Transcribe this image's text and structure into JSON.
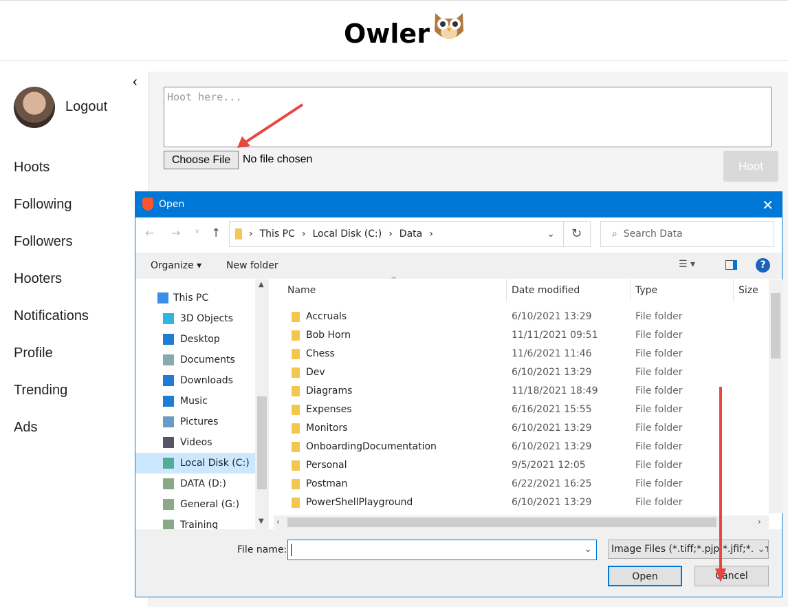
{
  "app": {
    "title": "Owler",
    "logo_icon": "owl-icon"
  },
  "sidebar": {
    "logout": "Logout",
    "items": [
      "Hoots",
      "Following",
      "Followers",
      "Hooters",
      "Notifications",
      "Profile",
      "Trending",
      "Ads"
    ]
  },
  "composer": {
    "placeholder": "Hoot here...",
    "choose_file": "Choose File",
    "no_file": "No file chosen",
    "hoot": "Hoot"
  },
  "dialog": {
    "title": "Open",
    "breadcrumb": [
      "This PC",
      "Local Disk (C:)",
      "Data"
    ],
    "search_placeholder": "Search Data",
    "organize": "Organize ▾",
    "new_folder": "New folder",
    "nav": [
      "This PC",
      "3D Objects",
      "Desktop",
      "Documents",
      "Downloads",
      "Music",
      "Pictures",
      "Videos",
      "Local Disk (C:)",
      "DATA (D:)",
      "General (G:)",
      "Training (\\\\atlsnf"
    ],
    "selected_nav": "Local Disk (C:)",
    "columns": [
      "Name",
      "Date modified",
      "Type",
      "Size"
    ],
    "files": [
      {
        "name": "Accruals",
        "date": "6/10/2021 13:29",
        "type": "File folder"
      },
      {
        "name": "Bob Horn",
        "date": "11/11/2021 09:51",
        "type": "File folder"
      },
      {
        "name": "Chess",
        "date": "11/6/2021 11:46",
        "type": "File folder"
      },
      {
        "name": "Dev",
        "date": "6/10/2021 13:29",
        "type": "File folder"
      },
      {
        "name": "Diagrams",
        "date": "11/18/2021 18:49",
        "type": "File folder"
      },
      {
        "name": "Expenses",
        "date": "6/16/2021 15:55",
        "type": "File folder"
      },
      {
        "name": "Monitors",
        "date": "6/10/2021 13:29",
        "type": "File folder"
      },
      {
        "name": "OnboardingDocumentation",
        "date": "6/10/2021 13:29",
        "type": "File folder"
      },
      {
        "name": "Personal",
        "date": "9/5/2021 12:05",
        "type": "File folder"
      },
      {
        "name": "Postman",
        "date": "6/22/2021 16:25",
        "type": "File folder"
      },
      {
        "name": "PowerShellPlayground",
        "date": "6/10/2021 13:29",
        "type": "File folder"
      }
    ],
    "file_name_label": "File name:",
    "file_name_value": "",
    "filter": "Image Files (*.tiff;*.pjp;*.jfif;*.bm",
    "open": "Open",
    "cancel": "Cancel"
  },
  "colors": {
    "titlebar": "#0078d7",
    "annotation_arrow": "#e8463f"
  }
}
